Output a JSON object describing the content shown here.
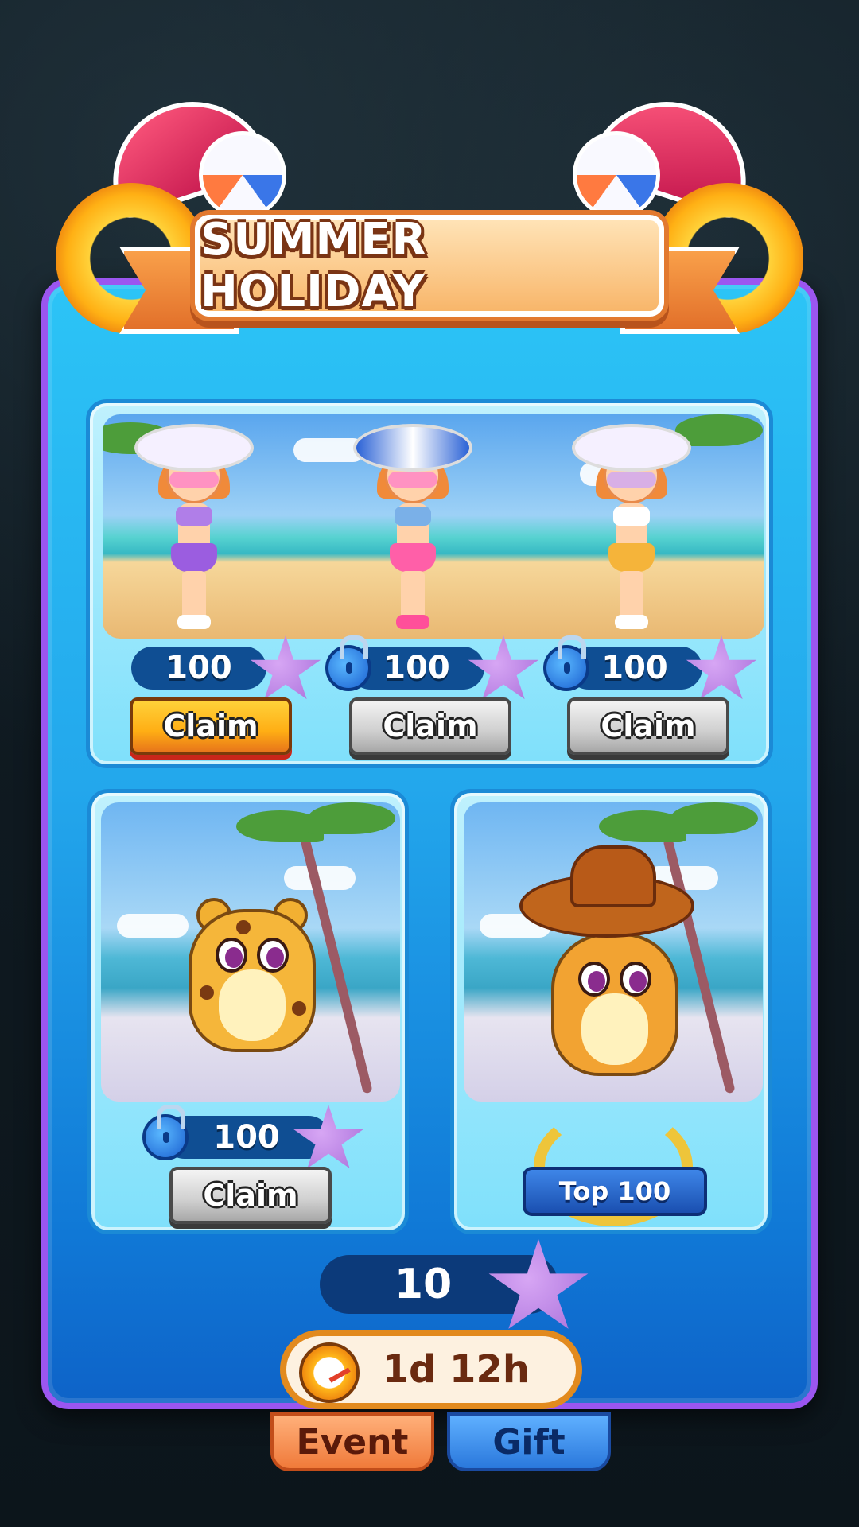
{
  "title": "SUMMER HOLIDAY",
  "rewards_top": [
    {
      "cost": "100",
      "button": "Claim",
      "state": "claimable",
      "locked": false
    },
    {
      "cost": "100",
      "button": "Claim",
      "state": "disabled",
      "locked": true
    },
    {
      "cost": "100",
      "button": "Claim",
      "state": "disabled",
      "locked": true
    }
  ],
  "rewards_bottom": {
    "left": {
      "cost": "100",
      "button": "Claim",
      "state": "disabled",
      "locked": true
    },
    "right": {
      "badge": "Top 100"
    }
  },
  "currency": {
    "amount": "10",
    "icon": "starfish-icon"
  },
  "timer": {
    "remaining": "1d 12h",
    "icon": "stopwatch-icon"
  },
  "tabs": {
    "event": "Event",
    "gift": "Gift"
  },
  "colors": {
    "claim_active": "#ffae14",
    "claim_disabled": "#cfcfcf",
    "panel": "#23a7ec",
    "panel_border": "#9b56f0"
  }
}
